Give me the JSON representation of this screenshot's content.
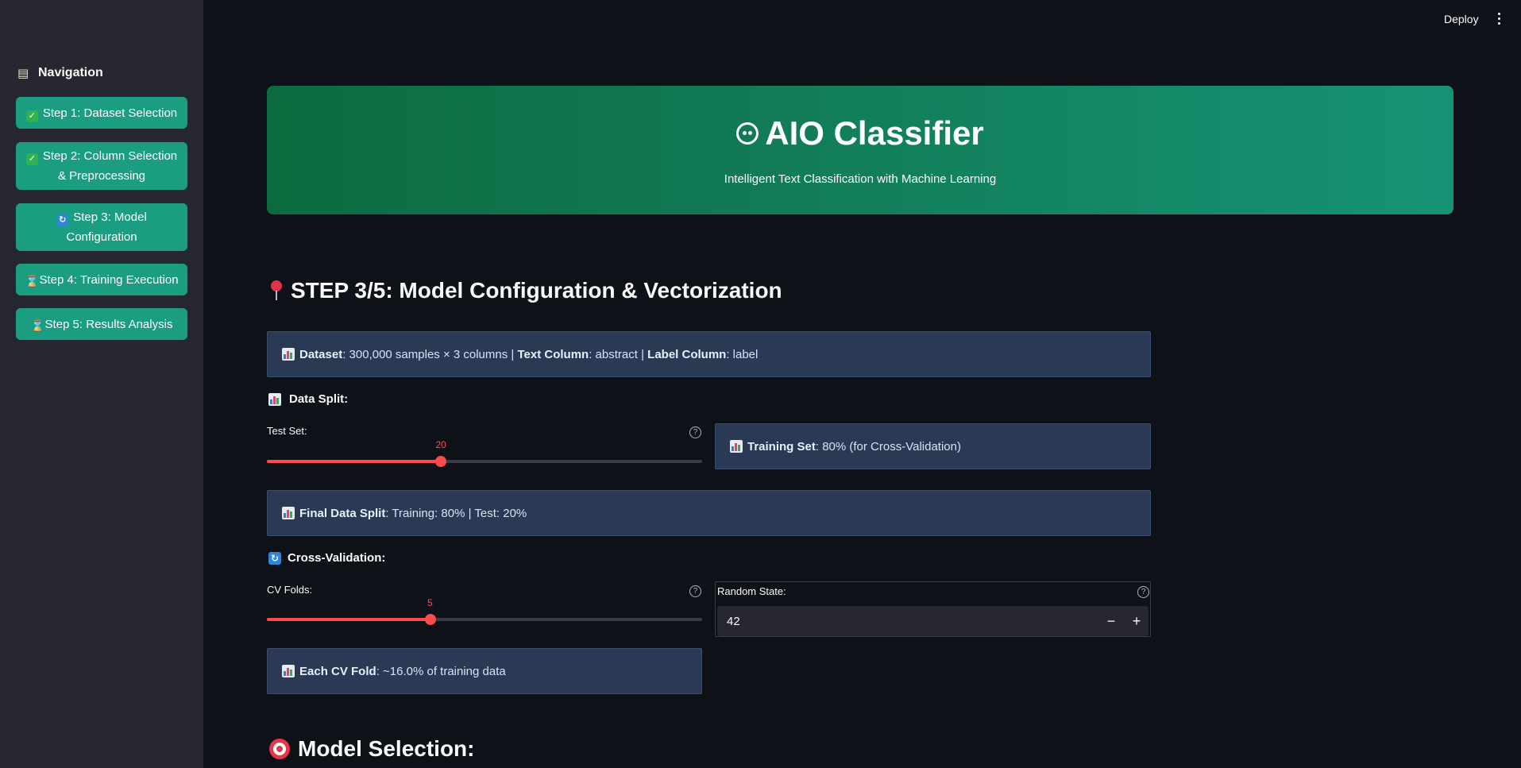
{
  "topbar": {
    "deploy_label": "Deploy"
  },
  "sidebar": {
    "title": "Navigation",
    "items": [
      {
        "label": "Step 1: Dataset Selection",
        "status": "check"
      },
      {
        "label": "Step 2: Column Selection & Preprocessing",
        "status": "check"
      },
      {
        "label": "Step 3: Model Configuration",
        "status": "in-progress"
      },
      {
        "label": "Step 4: Training Execution",
        "status": "pending"
      },
      {
        "label": "Step 5: Results Analysis",
        "status": "pending"
      }
    ]
  },
  "hero": {
    "title": "AIO Classifier",
    "subtitle": "Intelligent Text Classification with Machine Learning"
  },
  "step": {
    "heading": "STEP 3/5: Model Configuration & Vectorization"
  },
  "dataset_info": {
    "dataset_label": "Dataset",
    "dataset_value": ": 300,000 samples × 3 columns | ",
    "text_col_label": "Text Column",
    "text_col_value": ": abstract | ",
    "label_col_label": "Label Column",
    "label_col_value": ": label"
  },
  "data_split": {
    "heading": "Data Split:",
    "test_set_label": "Test Set:",
    "test_set_value": 20,
    "test_set_value_text": "20",
    "test_set_max": 50,
    "training_info_label": "Training Set",
    "training_info_value": ": 80% (for Cross-Validation)",
    "final_label": "Final Data Split",
    "final_value": ": Training: 80% | Test: 20%"
  },
  "cross_validation": {
    "heading": "Cross-Validation:",
    "folds_label": "CV Folds:",
    "folds_value": 5,
    "folds_value_text": "5",
    "folds_min": 2,
    "folds_max": 10,
    "random_state_label": "Random State:",
    "random_state_value": "42",
    "each_fold_label": "Each CV Fold",
    "each_fold_value": ": ~16.0% of training data"
  },
  "model_selection": {
    "heading": "Model Selection:"
  },
  "colors": {
    "accent": "#ff4b4b",
    "sidebar_button": "#1a9d80",
    "info_bg": "#2a3a55",
    "background": "#0e1117"
  }
}
